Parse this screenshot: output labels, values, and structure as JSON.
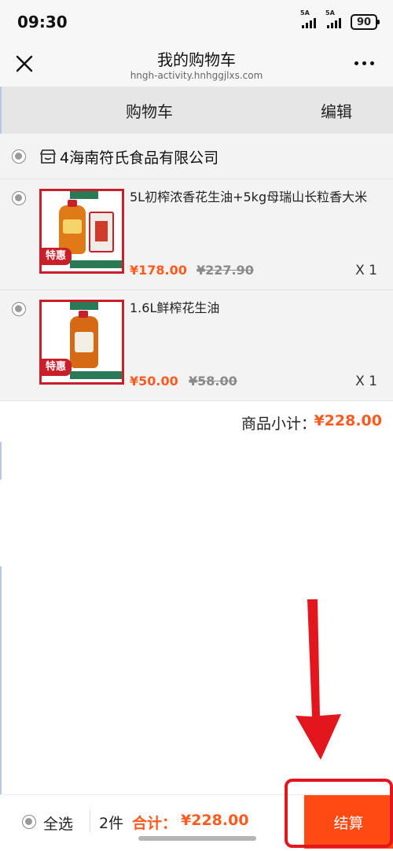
{
  "status_bar": {
    "time": "09:30",
    "signal1_label": "5A",
    "signal2_label": "5A",
    "battery": "90"
  },
  "nav": {
    "title": "我的购物车",
    "url": "hngh-activity.hnhggjlxs.com"
  },
  "cart_header": {
    "title": "购物车",
    "edit_label": "编辑"
  },
  "shop": {
    "name": "4海南符氏食品有限公司"
  },
  "items": [
    {
      "name": "5L初榨浓香花生油+5kg母瑞山长粒香大米",
      "price": "¥178.00",
      "old_price": "¥227.90",
      "qty": "X 1",
      "badge": "特惠"
    },
    {
      "name": "1.6L鲜榨花生油",
      "price": "¥50.00",
      "old_price": "¥58.00",
      "qty": "X 1",
      "badge": "特惠"
    }
  ],
  "subtotal": {
    "label": "商品小计：",
    "value": "¥228.00"
  },
  "bottom": {
    "select_all": "全选",
    "count": "2件",
    "total_label": "合计：",
    "total_value": "¥228.00",
    "checkout": "结算"
  },
  "colors": {
    "accent": "#ff5a1f",
    "checkout_bg": "#ff4a14",
    "annotation_red": "#e2161c"
  }
}
